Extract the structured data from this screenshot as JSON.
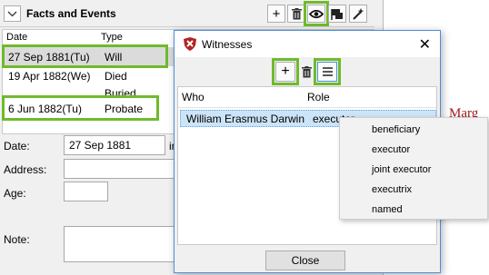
{
  "section": {
    "title": "Facts and Events"
  },
  "events_table": {
    "headers": [
      "Date",
      "Type"
    ],
    "rows": [
      {
        "date": "27 Sep 1881(Tu)",
        "type": "Will"
      },
      {
        "date": "19 Apr 1882(We)",
        "type": "Died"
      },
      {
        "date": "",
        "type": "Buried"
      },
      {
        "date": "6 Jun 1882(Tu)",
        "type": "Probate"
      }
    ]
  },
  "fields": {
    "date_label": "Date:",
    "date_value": "27 Sep 1881",
    "date_suffix": "in",
    "address_label": "Address:",
    "age_label": "Age:",
    "note_label": "Note:"
  },
  "side_heading": "Marg",
  "dialog": {
    "title": "Witnesses",
    "close_symbol": "✕",
    "headers": [
      "Who",
      "Role"
    ],
    "row": {
      "who": "William Erasmus Darwin",
      "role": "executor"
    },
    "close_label": "Close"
  },
  "role_menu": [
    "beneficiary",
    "executor",
    "joint executor",
    "executrix",
    "named"
  ],
  "colors": {
    "highlight": "#6fba2c",
    "selection": "#cce4f7",
    "accent_red": "#a01818"
  }
}
